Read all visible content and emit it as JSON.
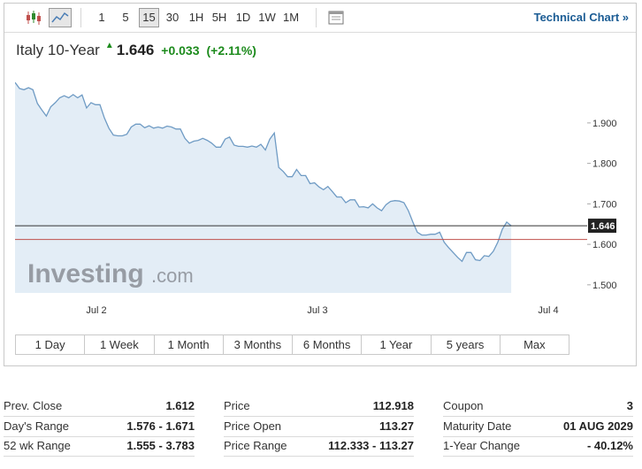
{
  "toolbar": {
    "timeframes": [
      "1",
      "5",
      "15",
      "30",
      "1H",
      "5H",
      "1D",
      "1W",
      "1M"
    ],
    "active_timeframe": "15",
    "technical_chart_label": "Technical Chart »"
  },
  "quote": {
    "name": "Italy 10-Year",
    "last": "1.646",
    "change": "+0.033",
    "change_pct": "(+2.11%)",
    "up_color": "#1d8b1d"
  },
  "watermark": {
    "brand": "Investing",
    "suffix": ".com"
  },
  "range_buttons": [
    "1 Day",
    "1 Week",
    "1 Month",
    "3 Months",
    "6 Months",
    "1 Year",
    "5 years",
    "Max"
  ],
  "chart_data": {
    "type": "area",
    "x": [
      0,
      1,
      2,
      3,
      4,
      5,
      6,
      7,
      8,
      9,
      10,
      11,
      12,
      13,
      14,
      15,
      16,
      17,
      18,
      19,
      20,
      21,
      22,
      23,
      24,
      25,
      26,
      27,
      28,
      29,
      30,
      31,
      32,
      33,
      34,
      35,
      36,
      37,
      38,
      39,
      40,
      41,
      42,
      43,
      44,
      45,
      46,
      47,
      48,
      49,
      50,
      51,
      52,
      53,
      54,
      55,
      56,
      57,
      58,
      59,
      60,
      61,
      62,
      63,
      64,
      65,
      66,
      67,
      68,
      69,
      70,
      71,
      72,
      73,
      74,
      75,
      76,
      77,
      78,
      79,
      80,
      81,
      82,
      83,
      84,
      85,
      86,
      87,
      88,
      89,
      90,
      91,
      92,
      93,
      94,
      95,
      96,
      97,
      98,
      99,
      100,
      101,
      102,
      103,
      104,
      105,
      106,
      107,
      108,
      109,
      110,
      111,
      112,
      113,
      114,
      115,
      116,
      117,
      118,
      119,
      120,
      121,
      122,
      123,
      124,
      125,
      126,
      127,
      128
    ],
    "values": [
      2.0,
      1.985,
      1.982,
      1.987,
      1.982,
      1.948,
      1.932,
      1.917,
      1.94,
      1.95,
      1.962,
      1.967,
      1.962,
      1.97,
      1.962,
      1.969,
      1.937,
      1.95,
      1.945,
      1.945,
      1.912,
      1.887,
      1.87,
      1.868,
      1.868,
      1.872,
      1.89,
      1.897,
      1.897,
      1.888,
      1.893,
      1.887,
      1.89,
      1.887,
      1.892,
      1.89,
      1.885,
      1.885,
      1.862,
      1.85,
      1.855,
      1.857,
      1.862,
      1.857,
      1.85,
      1.84,
      1.84,
      1.86,
      1.865,
      1.845,
      1.842,
      1.842,
      1.84,
      1.843,
      1.84,
      1.847,
      1.833,
      1.86,
      1.875,
      1.79,
      1.78,
      1.767,
      1.767,
      1.785,
      1.77,
      1.77,
      1.75,
      1.752,
      1.742,
      1.735,
      1.743,
      1.73,
      1.717,
      1.717,
      1.703,
      1.71,
      1.71,
      1.692,
      1.693,
      1.69,
      1.7,
      1.69,
      1.683,
      1.698,
      1.706,
      1.708,
      1.707,
      1.703,
      1.683,
      1.655,
      1.63,
      1.623,
      1.623,
      1.625,
      1.625,
      1.63,
      1.605,
      1.592,
      1.58,
      1.568,
      1.558,
      1.58,
      1.58,
      1.562,
      1.56,
      1.572,
      1.57,
      1.583,
      1.605,
      1.637,
      1.655,
      1.646,
      1.646,
      1.646,
      1.646,
      1.646,
      1.646,
      1.646,
      1.646,
      1.646,
      1.646,
      1.646,
      1.646,
      1.646,
      1.646,
      1.646,
      1.646,
      1.646,
      1.646
    ],
    "yticks": [
      "1.900",
      "1.800",
      "1.700",
      "1.600",
      "1.500"
    ],
    "xtick_labels": [
      "Jul 2",
      "Jul 3",
      "Jul 4"
    ],
    "ylim": [
      1.48,
      2.02
    ],
    "current_value": "1.646",
    "prev_close": 1.612,
    "line_color": "#6f9bc4",
    "fill_color": "#e3edf6",
    "current_line_color": "#333333",
    "prev_close_color": "#c0504d",
    "grid": false
  },
  "stats": [
    [
      {
        "k": "Prev. Close",
        "v": "1.612"
      },
      {
        "k": "Price",
        "v": "112.918"
      },
      {
        "k": "Coupon",
        "v": "3"
      }
    ],
    [
      {
        "k": "Day's Range",
        "v": "1.576 - 1.671"
      },
      {
        "k": "Price Open",
        "v": "113.27"
      },
      {
        "k": "Maturity Date",
        "v": "01 AUG 2029"
      }
    ],
    [
      {
        "k": "52 wk Range",
        "v": "1.555 - 3.783"
      },
      {
        "k": "Price Range",
        "v": "112.333 - 113.27"
      },
      {
        "k": "1-Year Change",
        "v": "- 40.12%"
      }
    ]
  ]
}
